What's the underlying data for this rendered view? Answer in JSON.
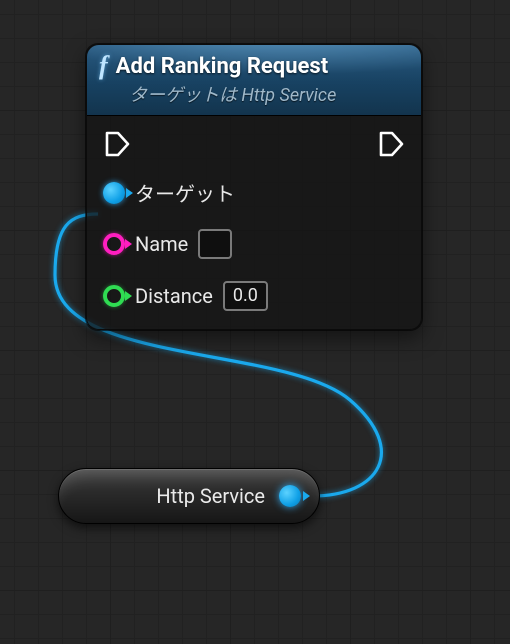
{
  "node": {
    "icon": "f",
    "title": "Add Ranking Request",
    "subtitle": "ターゲットは Http Service",
    "exec_in": true,
    "exec_out": true,
    "pins": {
      "target": {
        "label": "ターゲット"
      },
      "name": {
        "label": "Name",
        "value": ""
      },
      "distance": {
        "label": "Distance",
        "value": "0.0"
      }
    }
  },
  "httpServiceNode": {
    "label": "Http Service"
  },
  "colors": {
    "object_pin": "#1aa9ed",
    "string_pin": "#ff1ec0",
    "float_pin": "#2fdc52"
  }
}
